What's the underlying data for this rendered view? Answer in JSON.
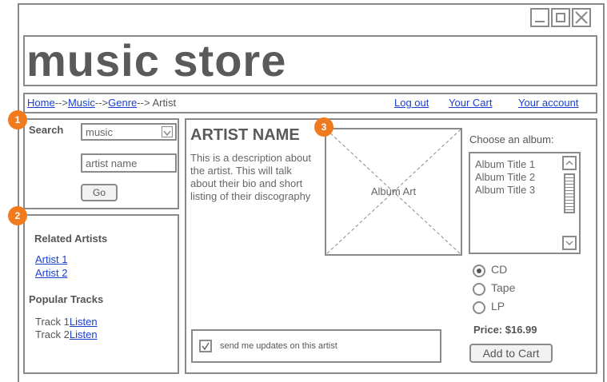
{
  "app": {
    "title": "music store"
  },
  "window": {
    "minimize": "",
    "maximize": "",
    "close": ""
  },
  "breadcrumb": {
    "home": "Home",
    "sep1": "-->",
    "music": "Music",
    "sep2": "-->",
    "genre": "Genre",
    "sep3": "-->",
    "current": "Artist"
  },
  "header_links": {
    "logout": "Log out",
    "cart": "Your Cart",
    "account": "Your account"
  },
  "badges": {
    "one": "1",
    "two": "2",
    "three": "3"
  },
  "search": {
    "label": "Search",
    "category_value": "music",
    "input_value": "artist name",
    "go_label": "Go"
  },
  "related": {
    "heading": "Related Artists",
    "artists": [
      "Artist 1",
      "Artist 2"
    ]
  },
  "popular": {
    "heading": "Popular Tracks",
    "tracks": [
      {
        "name": "Track 1",
        "action": "Listen"
      },
      {
        "name": "Track 2",
        "action": "Listen"
      }
    ]
  },
  "artist": {
    "name": "ARTIST NAME",
    "description": "This is a description about the artist.  This will talk about their bio and short listing of their discography",
    "album_art_caption": "Album Art"
  },
  "albums": {
    "heading": "Choose an album:",
    "items": [
      "Album Title 1",
      "Album Title 2",
      "Album Title 3"
    ]
  },
  "formats": {
    "options": [
      "CD",
      "Tape",
      "LP"
    ],
    "selected": "CD"
  },
  "purchase": {
    "price": "Price: $16.99",
    "add_to_cart": "Add to Cart"
  },
  "updates": {
    "checked": true,
    "label": "send me updates on this artist"
  },
  "colors": {
    "accent_badge": "#f07a1e",
    "link": "#1a3fd0",
    "wire": "#8a8a8a"
  }
}
